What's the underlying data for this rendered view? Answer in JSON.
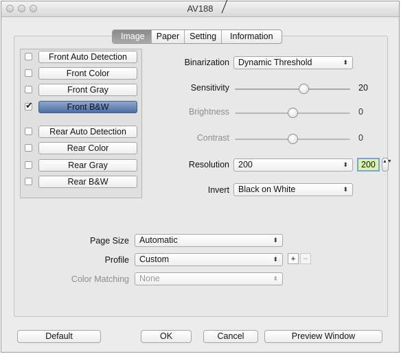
{
  "window": {
    "title": "AV188"
  },
  "tabs": [
    {
      "label": "Image",
      "active": true
    },
    {
      "label": "Paper",
      "active": false
    },
    {
      "label": "Setting",
      "active": false
    },
    {
      "label": "Information",
      "active": false
    }
  ],
  "modes": [
    {
      "label": "Front Auto Detection",
      "checked": false,
      "selected": false
    },
    {
      "label": "Front Color",
      "checked": false,
      "selected": false
    },
    {
      "label": "Front Gray",
      "checked": false,
      "selected": false
    },
    {
      "label": "Front B&W",
      "checked": true,
      "selected": true
    },
    {
      "label": "Rear Auto Detection",
      "checked": false,
      "selected": false
    },
    {
      "label": "Rear Color",
      "checked": false,
      "selected": false
    },
    {
      "label": "Rear Gray",
      "checked": false,
      "selected": false
    },
    {
      "label": "Rear B&W",
      "checked": false,
      "selected": false
    }
  ],
  "settings": {
    "binarization": {
      "label": "Binarization",
      "value": "Dynamic Threshold"
    },
    "sensitivity": {
      "label": "Sensitivity",
      "value": "20",
      "level": 0.6,
      "enabled": true
    },
    "brightness": {
      "label": "Brightness",
      "value": "0",
      "level": 0.5,
      "enabled": false
    },
    "contrast": {
      "label": "Contrast",
      "value": "0",
      "level": 0.5,
      "enabled": false
    },
    "resolution": {
      "label": "Resolution",
      "value": "200",
      "field_value": "200"
    },
    "invert": {
      "label": "Invert",
      "value": "Black on White"
    }
  },
  "page": {
    "page_size": {
      "label": "Page Size",
      "value": "Automatic"
    },
    "profile": {
      "label": "Profile",
      "value": "Custom",
      "add_label": "+",
      "remove_label": "−"
    },
    "color_matching": {
      "label": "Color Matching",
      "value": "None",
      "enabled": false
    }
  },
  "buttons": {
    "default": "Default",
    "ok": "OK",
    "cancel": "Cancel",
    "preview": "Preview Window"
  },
  "icons": {
    "checkmark": "✔",
    "popup_arrows": "⬍",
    "stepper": "▲▼"
  }
}
